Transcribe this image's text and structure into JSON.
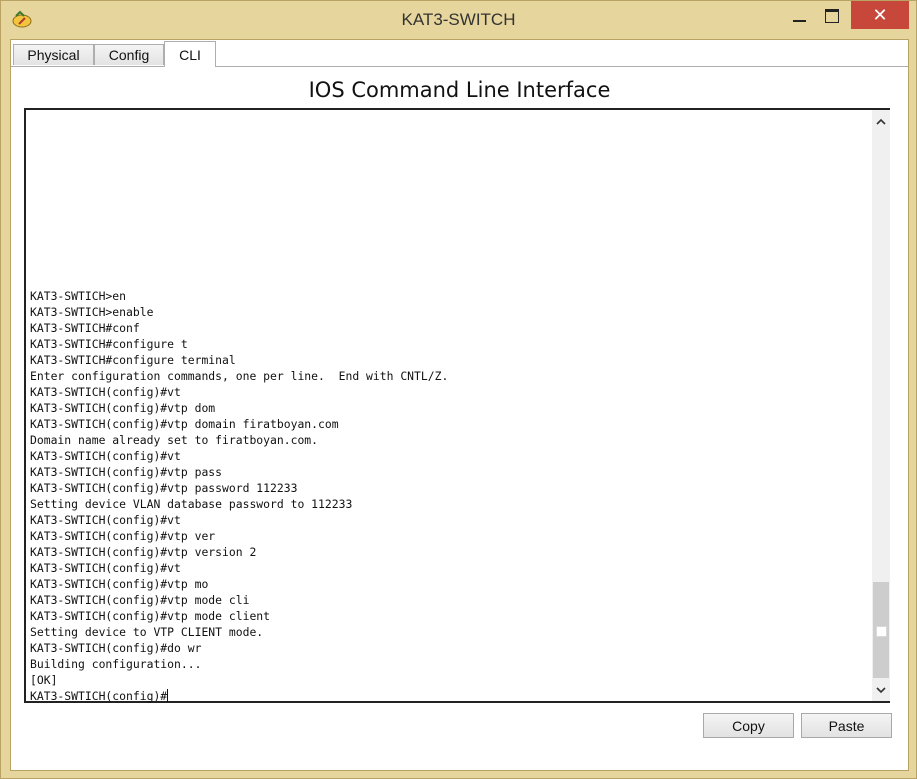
{
  "window": {
    "title": "KAT3-SWITCH",
    "minimize_icon": "minimize-icon",
    "maximize_icon": "maximize-icon",
    "close_icon": "close-icon",
    "close_glyph": "✕"
  },
  "tabs": [
    {
      "label": "Physical"
    },
    {
      "label": "Config"
    },
    {
      "label": "CLI"
    }
  ],
  "heading": "IOS Command Line Interface",
  "terminal": {
    "lines": [
      "KAT3-SWTICH>en",
      "KAT3-SWTICH>enable",
      "KAT3-SWTICH#conf",
      "KAT3-SWTICH#configure t",
      "KAT3-SWTICH#configure terminal",
      "Enter configuration commands, one per line.  End with CNTL/Z.",
      "KAT3-SWTICH(config)#vt",
      "KAT3-SWTICH(config)#vtp dom",
      "KAT3-SWTICH(config)#vtp domain firatboyan.com",
      "Domain name already set to firatboyan.com.",
      "KAT3-SWTICH(config)#vt",
      "KAT3-SWTICH(config)#vtp pass",
      "KAT3-SWTICH(config)#vtp password 112233",
      "Setting device VLAN database password to 112233",
      "KAT3-SWTICH(config)#vt",
      "KAT3-SWTICH(config)#vtp ver",
      "KAT3-SWTICH(config)#vtp version 2",
      "KAT3-SWTICH(config)#vt",
      "KAT3-SWTICH(config)#vtp mo",
      "KAT3-SWTICH(config)#vtp mode cli",
      "KAT3-SWTICH(config)#vtp mode client",
      "Setting device to VTP CLIENT mode.",
      "KAT3-SWTICH(config)#do wr",
      "Building configuration...",
      "[OK]"
    ],
    "prompt": "KAT3-SWTICH(config)#",
    "scroll_position": 1.0
  },
  "buttons": {
    "copy": "Copy",
    "paste": "Paste"
  }
}
